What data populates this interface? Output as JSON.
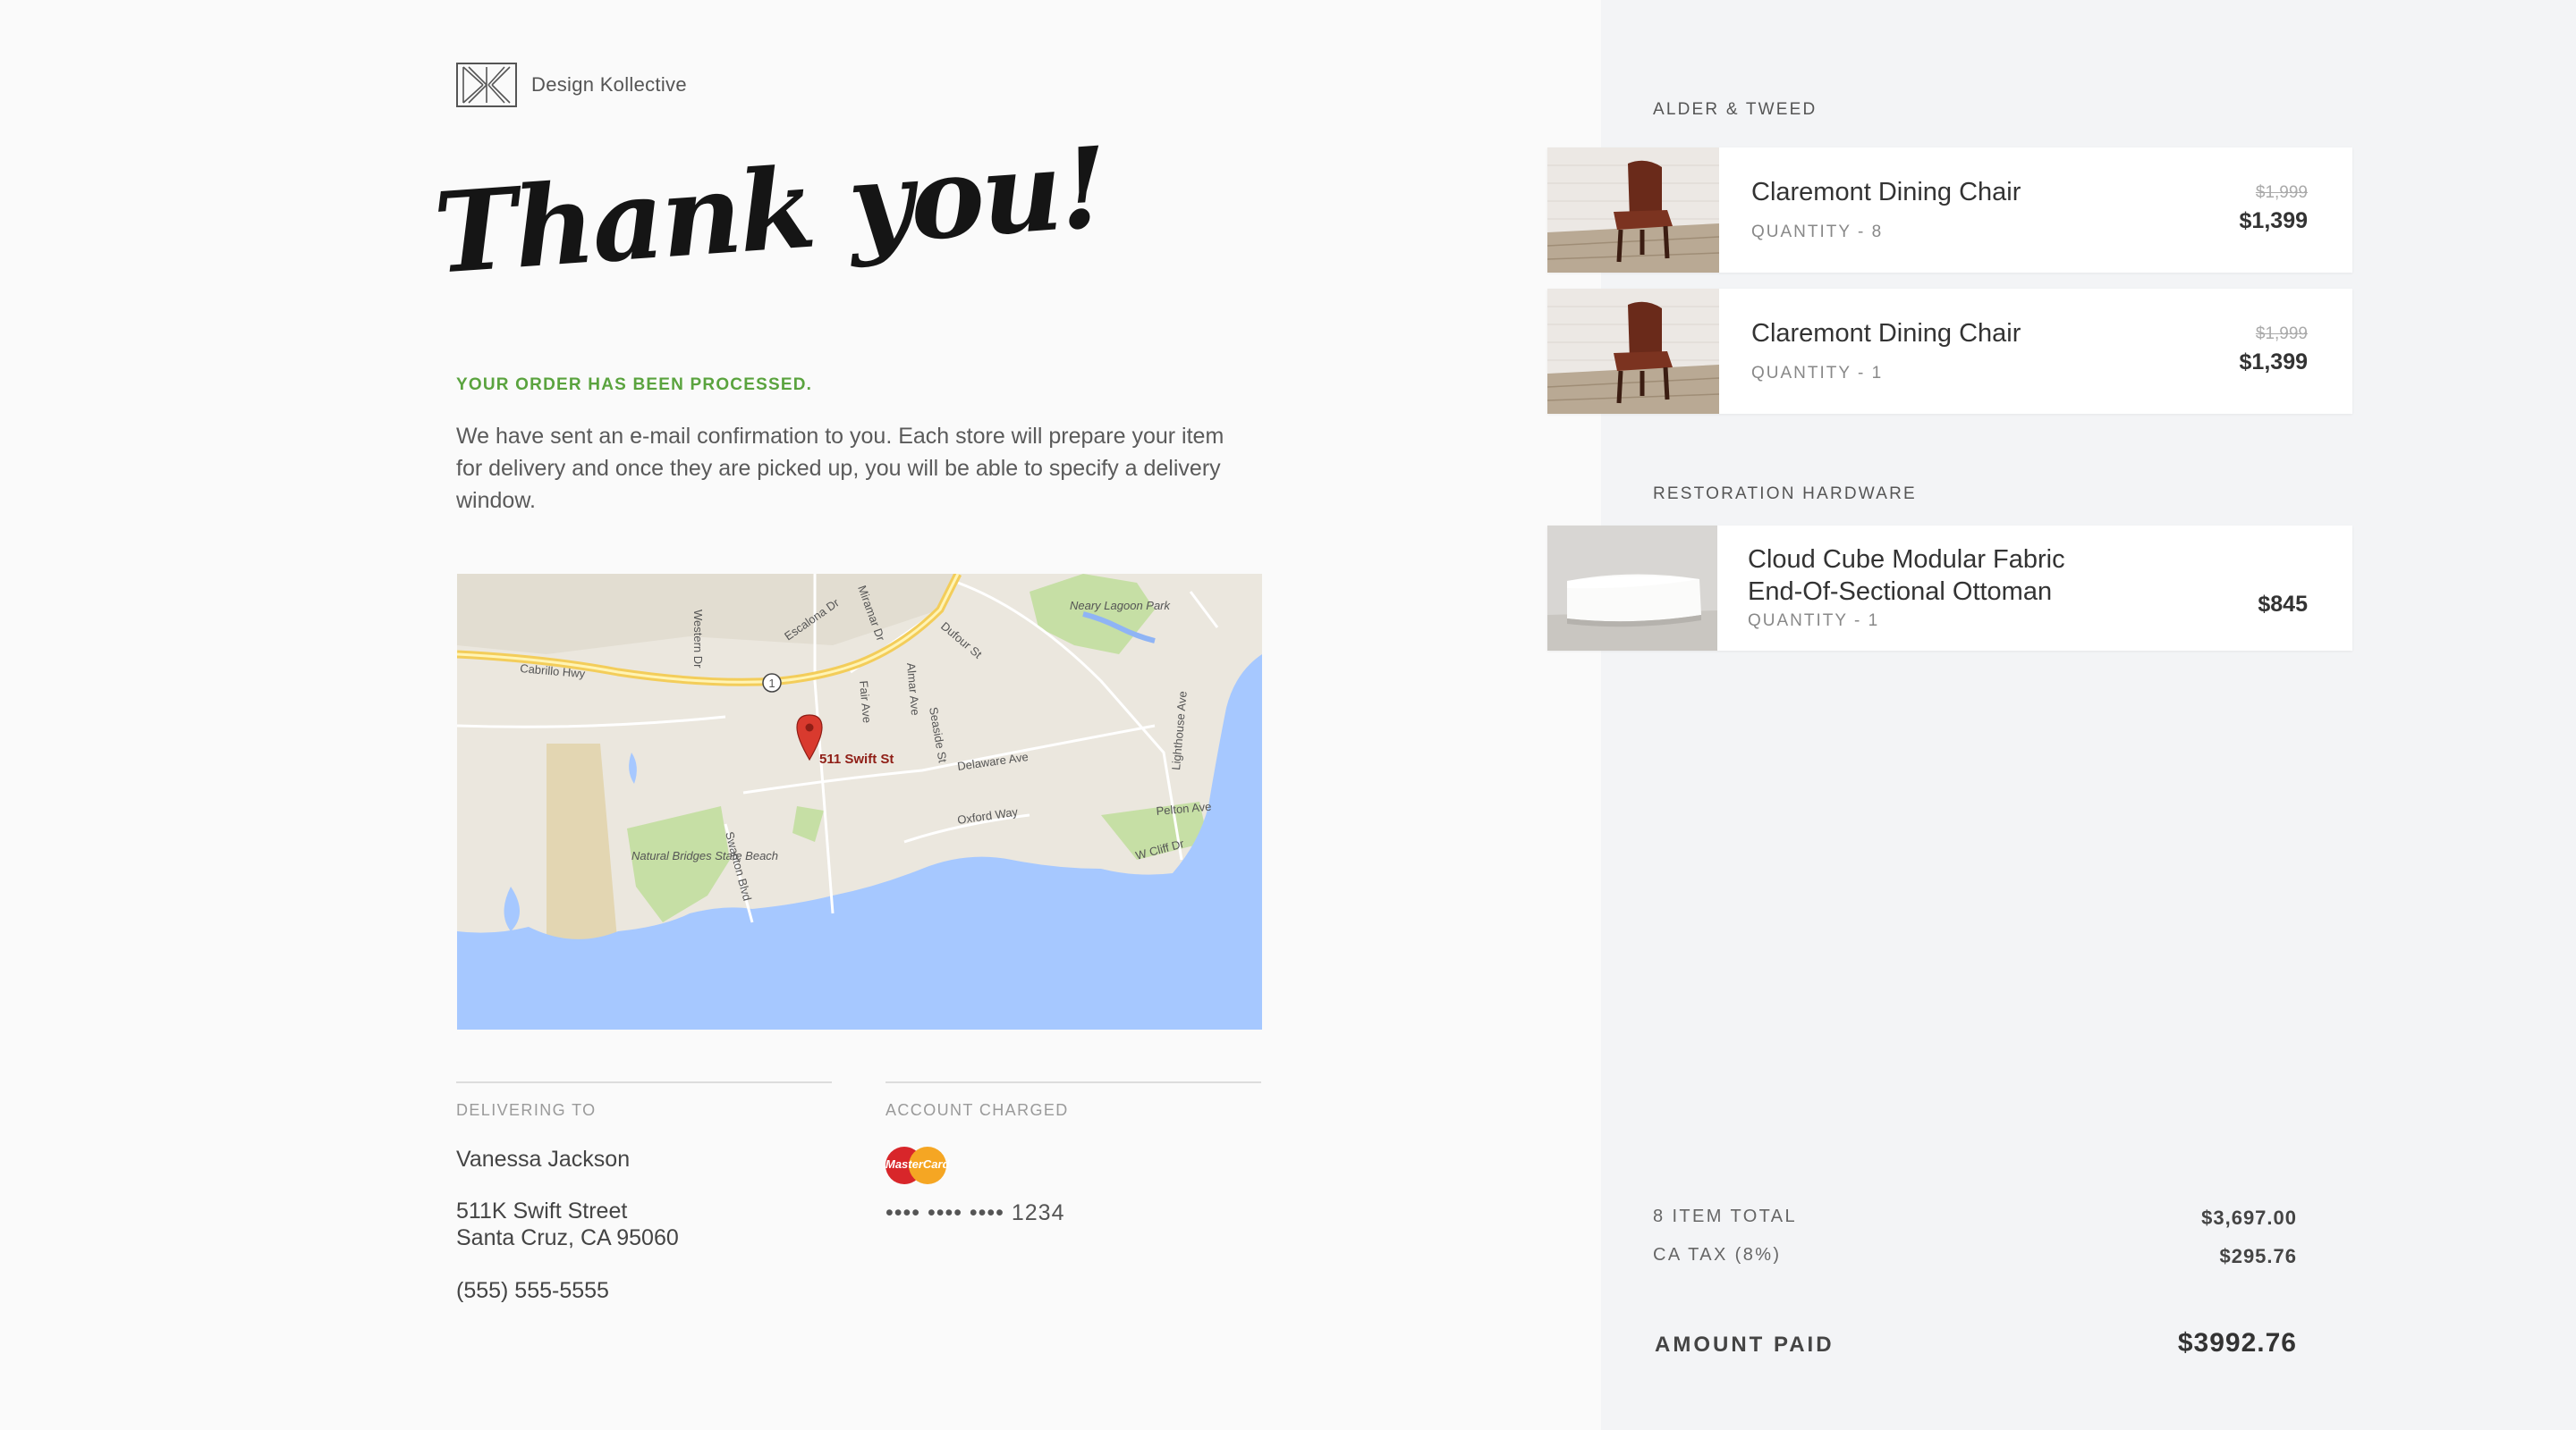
{
  "brand": {
    "name": "Design Kollective",
    "logo_icon": "dk-monogram-icon"
  },
  "hero": {
    "title": "Thank you!",
    "status": "YOUR ORDER HAS BEEN PROCESSED.",
    "message": "We have sent an e-mail confirmation to you. Each store will prepare your item for delivery and once they are picked up, you will be able to specify a delivery window."
  },
  "map": {
    "pin_label": "511 Swift St",
    "labels": [
      "Cabrillo Hwy",
      "Western Dr",
      "Escalona Dr",
      "Miramar Dr",
      "Dufour St",
      "Fair Ave",
      "Almar Ave",
      "Seaside St",
      "Delaware Ave",
      "Oxford Way",
      "Lighthouse Ave",
      "Pelton Ave",
      "W Cliff Dr",
      "Natural Bridges State Beach",
      "Swanton Blvd",
      "Neary Lagoon Park"
    ],
    "route_marker": "1"
  },
  "delivery": {
    "label": "DELIVERING TO",
    "name": "Vanessa Jackson",
    "street": "511K Swift Street",
    "city": "Santa Cruz, CA 95060",
    "phone": "(555) 555-5555"
  },
  "account": {
    "label": "ACCOUNT CHARGED",
    "card_brand": "MasterCard",
    "card_number": "•••• •••• •••• 1234"
  },
  "stores": [
    {
      "name": "ALDER & TWEED",
      "items": [
        {
          "title": "Claremont Dining Chair",
          "qty": "QUANTITY - 8",
          "old_price": "$1,999",
          "price": "$1,399"
        },
        {
          "title": "Claremont Dining Chair",
          "qty": "QUANTITY - 1",
          "old_price": "$1,999",
          "price": "$1,399"
        }
      ]
    },
    {
      "name": "RESTORATION HARDWARE",
      "items": [
        {
          "title_line1": "Cloud Cube Modular Fabric",
          "title_line2": "End-Of-Sectional Ottoman",
          "qty": "QUANTITY - 1",
          "price": "$845"
        }
      ]
    }
  ],
  "summary": {
    "items_label": "8 ITEM TOTAL",
    "items_value": "$3,697.00",
    "tax_label": "CA TAX (8%)",
    "tax_value": "$295.76",
    "paid_label": "AMOUNT PAID",
    "paid_value": "$3992.76"
  },
  "colors": {
    "accent_green": "#5aa33e",
    "panel_bg": "#f3f4f6",
    "water": "#a6c8ff",
    "land": "#ebe7de"
  }
}
